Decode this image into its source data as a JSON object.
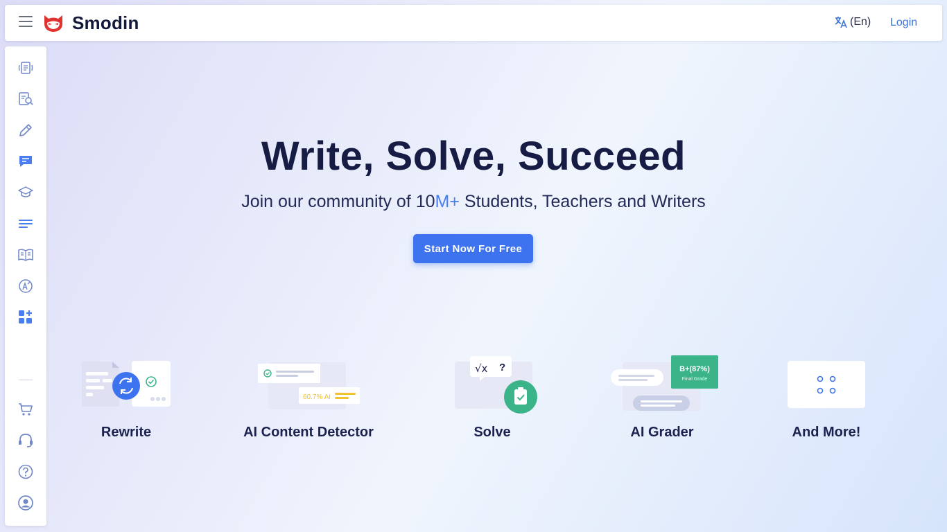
{
  "header": {
    "menu_icon": "hamburger-menu-icon",
    "brand": "Smodin",
    "language_label": "(En)",
    "language_icon": "translate-icon",
    "login_label": "Login"
  },
  "sidebar": {
    "items": [
      {
        "icon": "rewrite-doc-icon"
      },
      {
        "icon": "search-doc-icon"
      },
      {
        "icon": "pencil-icon"
      },
      {
        "icon": "chat-icon"
      },
      {
        "icon": "graduation-cap-icon"
      },
      {
        "icon": "text-lines-icon"
      },
      {
        "icon": "book-icon"
      },
      {
        "icon": "grammar-icon"
      },
      {
        "icon": "add-apps-icon"
      }
    ],
    "bottom_items": [
      {
        "icon": "cart-icon"
      },
      {
        "icon": "headset-icon"
      },
      {
        "icon": "help-icon"
      },
      {
        "icon": "user-account-icon"
      }
    ]
  },
  "hero": {
    "title": "Write, Solve, Succeed",
    "subtitle_before": "Join our community of 10",
    "subtitle_highlight": "M+",
    "subtitle_after": " Students, Teachers and Writers",
    "cta_label": "Start Now For Free"
  },
  "features": [
    {
      "label": "Rewrite"
    },
    {
      "label": "AI Content Detector",
      "badge": "60.7% AI"
    },
    {
      "label": "Solve",
      "math_text": "√x",
      "question_mark": "?"
    },
    {
      "label": "AI Grader",
      "grade": "B+(87%)",
      "grade_caption": "Final Grade"
    },
    {
      "label": "And More!"
    }
  ],
  "colors": {
    "accent": "#3d73ee",
    "brand_red": "#e0322f",
    "success_green": "#3bb48a",
    "warning_yellow": "#f2c230"
  }
}
